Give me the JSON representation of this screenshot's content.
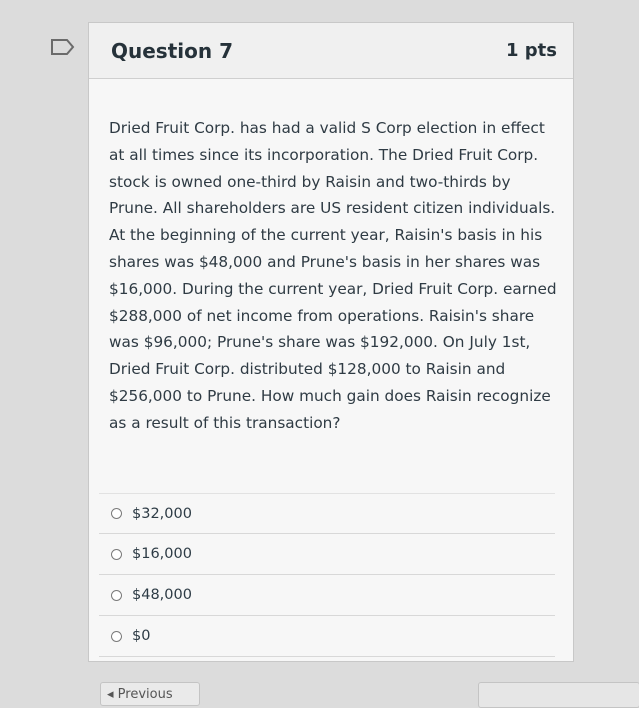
{
  "question": {
    "title": "Question 7",
    "points": "1 pts",
    "text": "Dried Fruit Corp. has had a valid S Corp election in effect at all times since its incorporation. The Dried Fruit Corp. stock is owned one-third by Raisin and two-thirds by Prune. All shareholders are US resident citizen individuals. At the beginning of the current year, Raisin's basis in his shares was $48,000 and Prune's basis in her shares was $16,000. During the current year, Dried Fruit Corp. earned $288,000 of net income from operations. Raisin's share was $96,000; Prune's share was $192,000. On July 1st, Dried Fruit Corp. distributed $128,000 to Raisin and $256,000 to Prune. How much gain does Raisin recognize as a result of this transaction?"
  },
  "answers": [
    {
      "label": "$32,000"
    },
    {
      "label": "$16,000"
    },
    {
      "label": "$48,000"
    },
    {
      "label": "$0"
    }
  ],
  "nav": {
    "previous_label": "◂ Previous"
  },
  "colors": {
    "background": "#dcdcdc",
    "card": "#f7f7f7",
    "text": "#2d3b45"
  },
  "icons": {
    "flag": "bookmark-flag-icon"
  }
}
